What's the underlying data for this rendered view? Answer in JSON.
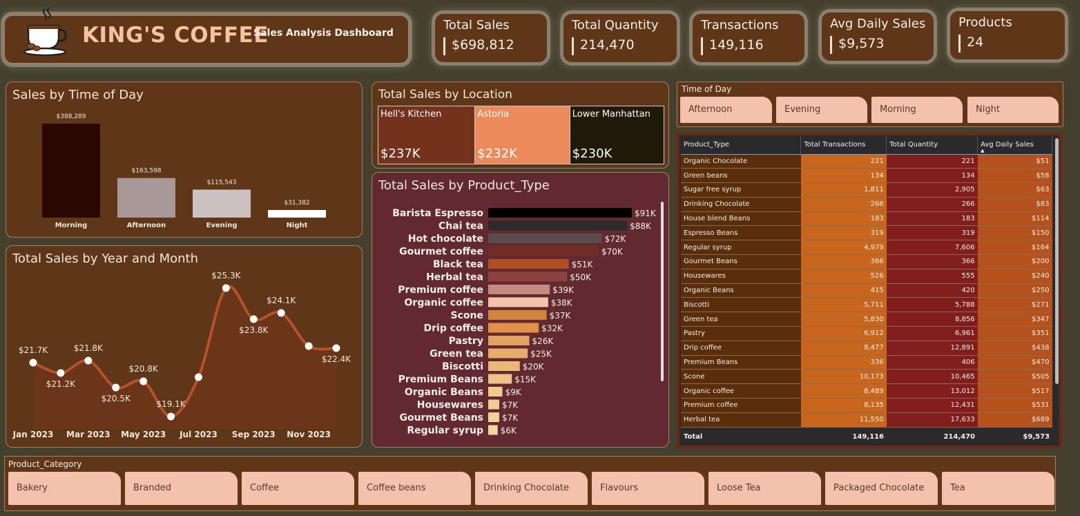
{
  "brand": {
    "title": "KING'S COFFEE",
    "subtitle": "Sales Analysis Dashboard",
    "logo_icon": "coffee-cup-icon"
  },
  "kpis": [
    {
      "label": "Total Sales",
      "value": "$698,812"
    },
    {
      "label": "Total Quantity",
      "value": "214,470"
    },
    {
      "label": "Transactions",
      "value": "149,116"
    },
    {
      "label": "Avg Daily Sales",
      "value": "$9,573"
    },
    {
      "label": "Products",
      "value": "24"
    }
  ],
  "time_of_day_chart": {
    "title": "Sales by Time of Day",
    "chart_data": {
      "type": "bar",
      "categories": [
        "Morning",
        "Afternoon",
        "Evening",
        "Night"
      ],
      "values": [
        388289,
        163598,
        115543,
        31382
      ],
      "labels": [
        "$388,289",
        "$163,598",
        "$115,543",
        "$31,382"
      ],
      "colors": [
        "#2a0703",
        "#a99898",
        "#cbc1c1",
        "#ffffff"
      ]
    }
  },
  "location_chart": {
    "title": "Total Sales by Location",
    "chart_data": {
      "type": "treemap",
      "categories": [
        "Hell's Kitchen",
        "Astoria",
        "Lower Manhattan"
      ],
      "labels": [
        "$237K",
        "$232K",
        "$230K"
      ],
      "colors": [
        "#74311c",
        "#ec8a5c",
        "#1f1a0a"
      ]
    }
  },
  "product_type_chart": {
    "title": "Total Sales by Product_Type",
    "chart_data": {
      "type": "bar",
      "orientation": "horizontal",
      "categories": [
        "Barista Espresso",
        "Chai tea",
        "Hot chocolate",
        "Gourmet coffee",
        "Black tea",
        "Herbal tea",
        "Premium coffee",
        "Organic coffee",
        "Scone",
        "Drip coffee",
        "Pastry",
        "Green tea",
        "Biscotti",
        "Premium Beans",
        "Organic Beans",
        "Housewares",
        "Gourmet Beans",
        "Regular syrup"
      ],
      "values": [
        91,
        88,
        72,
        70,
        51,
        50,
        39,
        38,
        37,
        32,
        26,
        25,
        20,
        15,
        9,
        7,
        7,
        6
      ],
      "labels": [
        "$91K",
        "$88K",
        "$72K",
        "$70K",
        "$51K",
        "$50K",
        "$39K",
        "$38K",
        "$37K",
        "$32K",
        "$26K",
        "$25K",
        "$20K",
        "$15K",
        "$9K",
        "$7K",
        "$7K",
        "$6K"
      ],
      "colors": [
        "#000000",
        "#2b2b2b",
        "#5b4b4e",
        "#6f2d24",
        "#b04e24",
        "#8c4340",
        "#c58a80",
        "#f3c3aa",
        "#d1843a",
        "#e0924a",
        "#e2a264",
        "#e8ac6c",
        "#ebb879",
        "#eec28a",
        "#f0c990",
        "#f2ce95",
        "#f3d19a",
        "#f5d6a0"
      ]
    }
  },
  "year_month_chart": {
    "title": "Total Sales by Year and Month",
    "chart_data": {
      "type": "area",
      "x": [
        "Jan 2023",
        "Feb 2023",
        "Mar 2023",
        "Apr 2023",
        "May 2023",
        "Jun 2023",
        "Jul 2023",
        "Aug 2023",
        "Sep 2023",
        "Oct 2023",
        "Nov 2023",
        "Dec 2023"
      ],
      "values": [
        21.7,
        21.2,
        21.8,
        20.5,
        20.8,
        19.1,
        21.0,
        25.3,
        23.8,
        24.1,
        22.5,
        22.4
      ],
      "labels": [
        "$21.7K",
        "$21.2K",
        "$21.8K",
        "$20.5K",
        "$20.8K",
        "$19.1K",
        "",
        "$25.3K",
        "$23.8K",
        "$24.1K",
        "",
        "$22.4K"
      ],
      "tick_labels": [
        "Jan 2023",
        "Mar 2023",
        "May 2023",
        "Jul 2023",
        "Sep 2023",
        "Nov 2023"
      ],
      "line_color": "#b5512c",
      "fill_color": "#6a3518"
    }
  },
  "time_slicer": {
    "title": "Time of Day",
    "options": [
      "Afternoon",
      "Evening",
      "Morning",
      "Night"
    ]
  },
  "category_slicer": {
    "title": "Product_Category",
    "options": [
      "Bakery",
      "Branded",
      "Coffee",
      "Coffee beans",
      "Drinking Chocolate",
      "Flavours",
      "Loose Tea",
      "Packaged Chocolate",
      "Tea"
    ]
  },
  "product_table": {
    "columns": [
      "Product_Type",
      "Total Transactions",
      "Total Quantity",
      "Avg Daily Sales"
    ],
    "sort_indicator": "▲",
    "rows": [
      [
        "Organic Chocolate",
        "221",
        "221",
        "$51"
      ],
      [
        "Green beans",
        "134",
        "134",
        "$58"
      ],
      [
        "Sugar free syrup",
        "1,811",
        "2,905",
        "$63"
      ],
      [
        "Drinking Chocolate",
        "266",
        "266",
        "$83"
      ],
      [
        "House blend Beans",
        "183",
        "183",
        "$114"
      ],
      [
        "Espresso Beans",
        "319",
        "319",
        "$150"
      ],
      [
        "Regular syrup",
        "4,979",
        "7,606",
        "$164"
      ],
      [
        "Gourmet Beans",
        "366",
        "366",
        "$200"
      ],
      [
        "Housewares",
        "526",
        "555",
        "$240"
      ],
      [
        "Organic Beans",
        "415",
        "420",
        "$250"
      ],
      [
        "Biscotti",
        "5,711",
        "5,788",
        "$271"
      ],
      [
        "Green tea",
        "5,830",
        "8,856",
        "$347"
      ],
      [
        "Pastry",
        "6,912",
        "6,961",
        "$351"
      ],
      [
        "Drip coffee",
        "8,477",
        "12,891",
        "$438"
      ],
      [
        "Premium Beans",
        "336",
        "406",
        "$470"
      ],
      [
        "Scone",
        "10,173",
        "10,465",
        "$505"
      ],
      [
        "Organic coffee",
        "8,489",
        "13,012",
        "$517"
      ],
      [
        "Premium coffee",
        "8,135",
        "12,431",
        "$531"
      ],
      [
        "Herbal tea",
        "11,550",
        "17,633",
        "$689"
      ]
    ],
    "total": [
      "Total",
      "149,116",
      "214,470",
      "$9,573"
    ]
  }
}
